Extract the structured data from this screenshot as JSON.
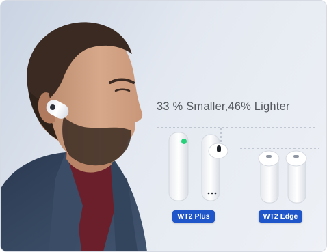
{
  "headline": "33 % Smaller,46% Lighter",
  "products": [
    {
      "label": "WT2 Plus"
    },
    {
      "label": "WT2 Edge"
    }
  ],
  "colors": {
    "badge": "#1f56c9",
    "background": "#dfe5ee",
    "jacket": "#34465e",
    "shirt": "#6b1f2a",
    "earbud": "#f7f8fa",
    "led": "#27d07a"
  }
}
